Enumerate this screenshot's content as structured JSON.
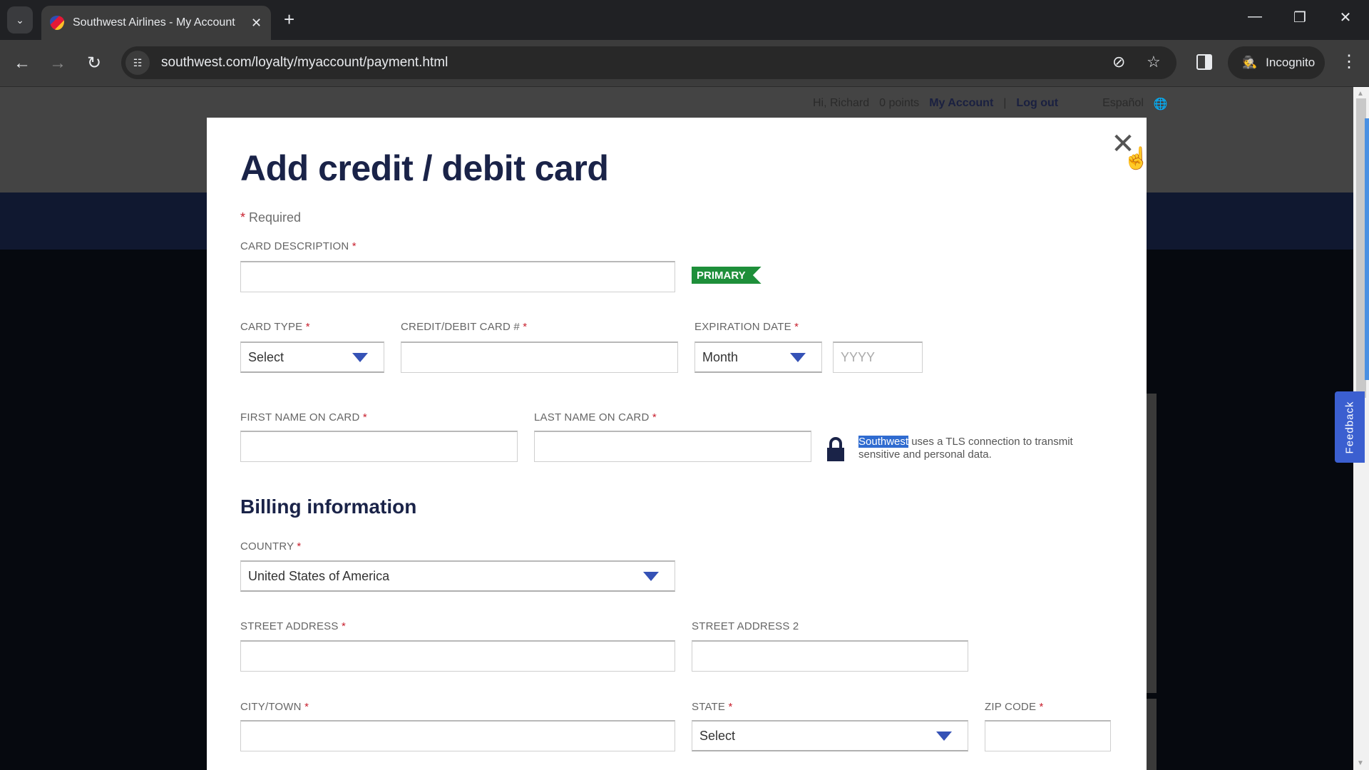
{
  "browser": {
    "tab_title": "Southwest Airlines - My Account",
    "url": "southwest.com/loyalty/myaccount/payment.html",
    "profile_label": "Incognito",
    "icons": {
      "tab_list": "chevron-down-icon",
      "close_tab": "close-icon",
      "new_tab": "plus-icon",
      "back": "arrow-left-icon",
      "forward": "arrow-right-icon",
      "reload": "reload-icon",
      "site_info": "tune-icon",
      "tracking": "eye-off-icon",
      "bookmark": "star-icon",
      "side_panel": "side-panel-icon",
      "menu": "kebab-icon"
    },
    "glyphs": {
      "tab_list": "⌄",
      "close_tab": "✕",
      "new_tab": "+",
      "back": "←",
      "forward": "→",
      "reload": "↻",
      "site_info": "☷",
      "tracking": "⊘",
      "bookmark": "☆",
      "incognito": "🕵",
      "menu": "⋮",
      "minimize": "—",
      "restore": "❐",
      "close_window": "✕"
    }
  },
  "page": {
    "topbar": {
      "greeting": "Hi, Richard",
      "points": "0 points",
      "my_account": "My Account",
      "separator": "|",
      "log_out": "Log out",
      "language": "Español",
      "globe_glyph": "🌐"
    },
    "feedback_label": "Feedback",
    "scroll_up": "▲",
    "scroll_down": "▼"
  },
  "modal": {
    "title": "Add credit / debit card",
    "close_glyph": "✕",
    "cursor_glyph": "☝",
    "required_star": "*",
    "required_note": " Required",
    "card_description": {
      "label": "CARD DESCRIPTION",
      "value": ""
    },
    "primary_badge": "PRIMARY",
    "card_type": {
      "label": "CARD TYPE",
      "value": "Select"
    },
    "card_number": {
      "label": "CREDIT/DEBIT CARD #",
      "value": ""
    },
    "expiration": {
      "label": "EXPIRATION DATE",
      "month_value": "Month",
      "year_placeholder": "YYYY"
    },
    "first_name": {
      "label": "FIRST NAME ON CARD",
      "value": ""
    },
    "last_name": {
      "label": "LAST NAME ON CARD",
      "value": ""
    },
    "tls_note": {
      "highlight": "Southwest",
      "text": " uses a TLS connection to transmit sensitive and personal data."
    },
    "billing_heading": "Billing information",
    "country": {
      "label": "COUNTRY",
      "value": "United States of America"
    },
    "street_address": {
      "label": "STREET ADDRESS",
      "value": ""
    },
    "street_address_2": {
      "label": "STREET ADDRESS 2",
      "value": ""
    },
    "city": {
      "label": "CITY/TOWN",
      "value": ""
    },
    "state": {
      "label": "STATE",
      "value": "Select"
    },
    "zip": {
      "label": "ZIP CODE",
      "value": ""
    }
  },
  "colors": {
    "accent_navy": "#1a2348",
    "caret_blue": "#3552b6",
    "primary_green": "#1e8f3a",
    "required_red": "#c8202e",
    "feedback_blue": "#3b5fd0"
  }
}
